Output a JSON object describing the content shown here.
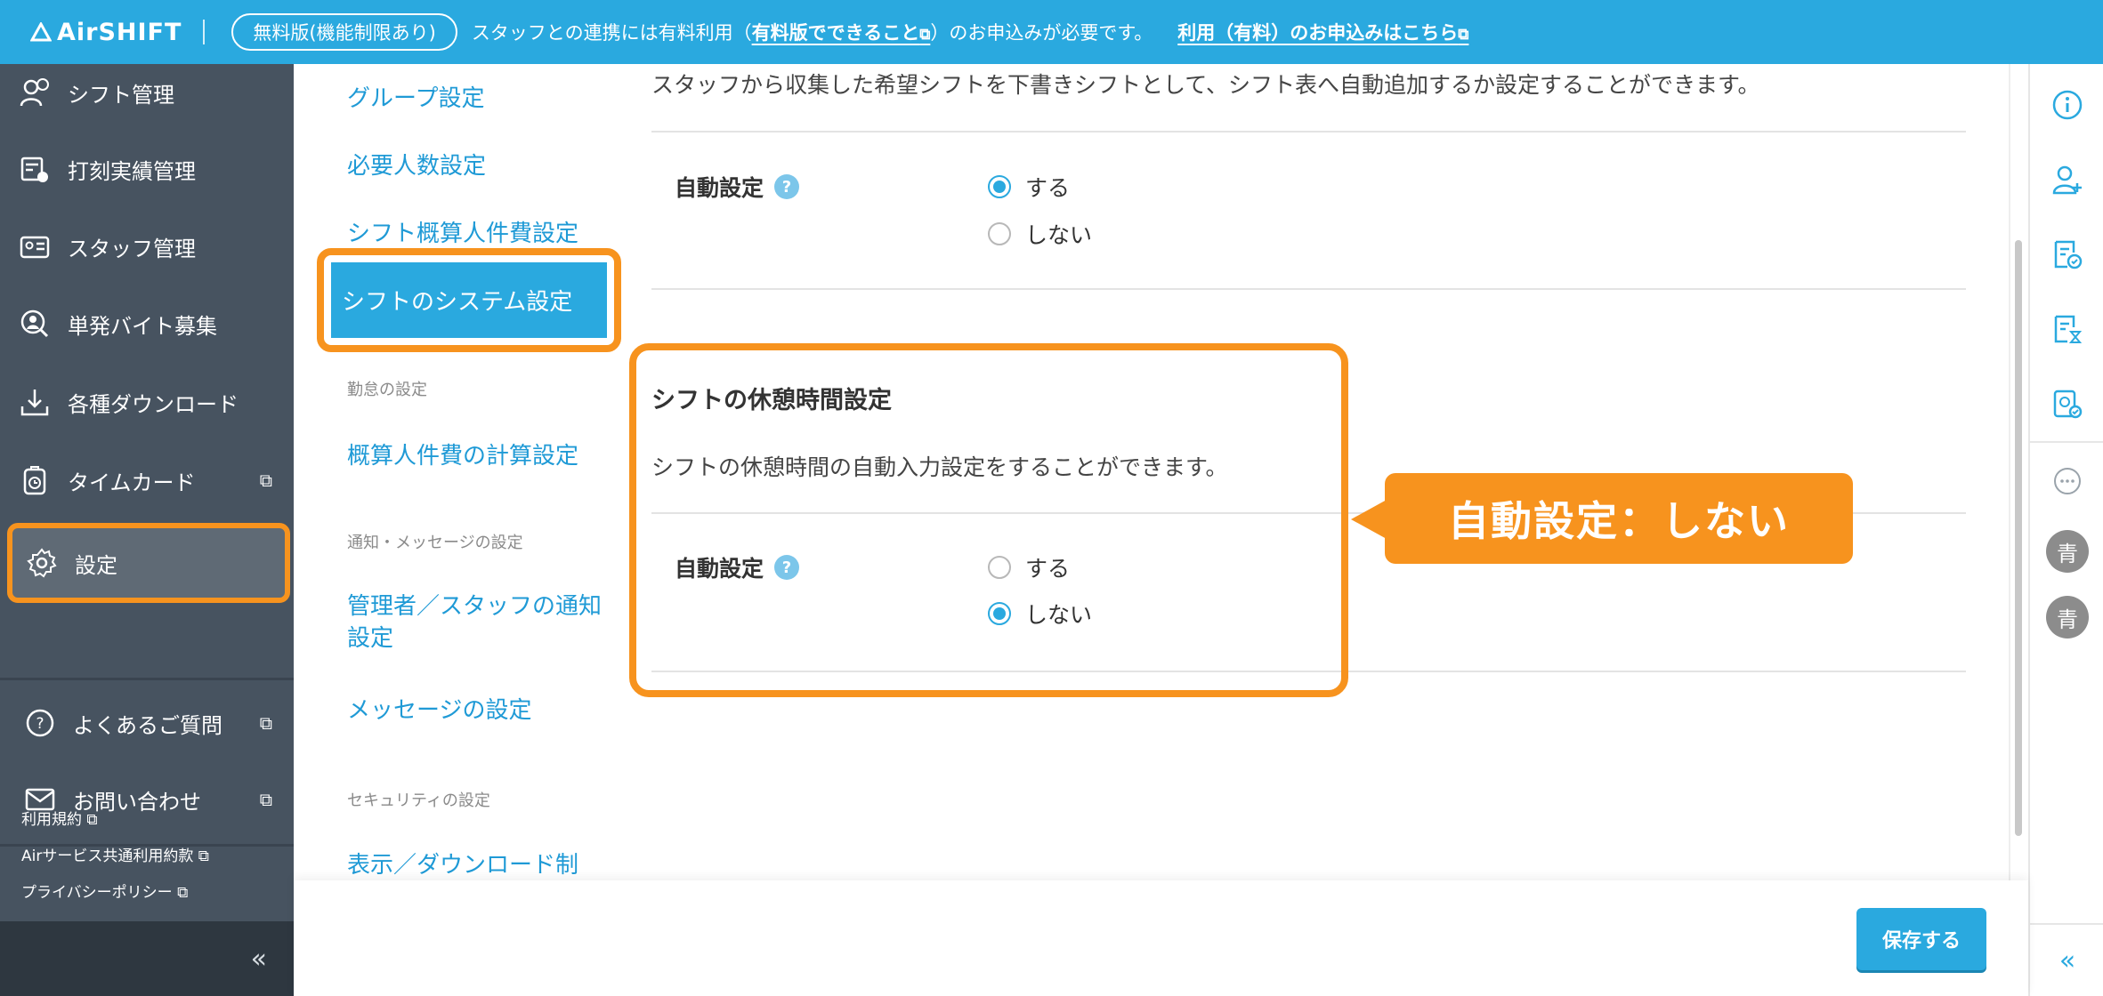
{
  "banner": {
    "logo": "AirSHIFT",
    "plan_badge": "無料版(機能制限あり)",
    "text_before": "スタッフとの連携には有料利用（",
    "feature_link": "有料版でできること",
    "text_after": "）のお申込みが必要です。",
    "apply_link": "利用（有料）のお申込みはこちら",
    "ext_glyph": "⧉",
    "color": "#2aa9df"
  },
  "sidebar": {
    "items": [
      {
        "label": "シフト管理",
        "icon": "shift-icon"
      },
      {
        "label": "打刻実績管理",
        "icon": "clock-sheet-icon"
      },
      {
        "label": "スタッフ管理",
        "icon": "staff-card-icon"
      },
      {
        "label": "単発バイト募集",
        "icon": "person-search-icon"
      },
      {
        "label": "各種ダウンロード",
        "icon": "download-icon"
      },
      {
        "label": "タイムカード",
        "icon": "timecard-icon",
        "external": true
      },
      {
        "label": "設定",
        "icon": "gear-icon",
        "active": true
      }
    ],
    "help": [
      {
        "label": "よくあるご質問",
        "icon": "question-icon"
      },
      {
        "label": "お問い合わせ",
        "icon": "mail-icon"
      }
    ],
    "legal": [
      "利用規約",
      "Airサービス共通利用約款",
      "プライバシーポリシー"
    ],
    "collapse": "«",
    "ext_glyph": "⧉"
  },
  "subnav": {
    "items": [
      "グループ設定",
      "必要人数設定",
      "シフト概算人件費設定"
    ],
    "active": "シフトのシステム設定",
    "groups": {
      "attendance": "勤怠の設定",
      "notification": "通知・メッセージの設定",
      "security": "セキュリティの設定"
    },
    "attendance_items": [
      "概算人件費の計算設定"
    ],
    "notification_items": [
      "管理者／スタッフの通知設定",
      "メッセージの設定"
    ],
    "security_items": [
      "表示／ダウンロード制"
    ]
  },
  "main": {
    "intro": "スタッフから収集した希望シフトを下書きシフトとして、シフト表へ自動追加するか設定することができます。",
    "draft": {
      "label": "自動設定",
      "help": "?",
      "options": [
        "する",
        "しない"
      ],
      "selected": "する"
    },
    "break_section": {
      "title": "シフトの休憩時間設定",
      "description": "シフトの休憩時間の自動入力設定をすることができます。",
      "label": "自動設定",
      "help": "?",
      "options": [
        "する",
        "しない"
      ],
      "selected": "しない"
    }
  },
  "callout": {
    "text": "自動設定：しない",
    "color": "#f7931e"
  },
  "rail": {
    "avatars": [
      "青",
      "青"
    ],
    "collapse": "«"
  },
  "footer": {
    "save_label": "保存する"
  }
}
